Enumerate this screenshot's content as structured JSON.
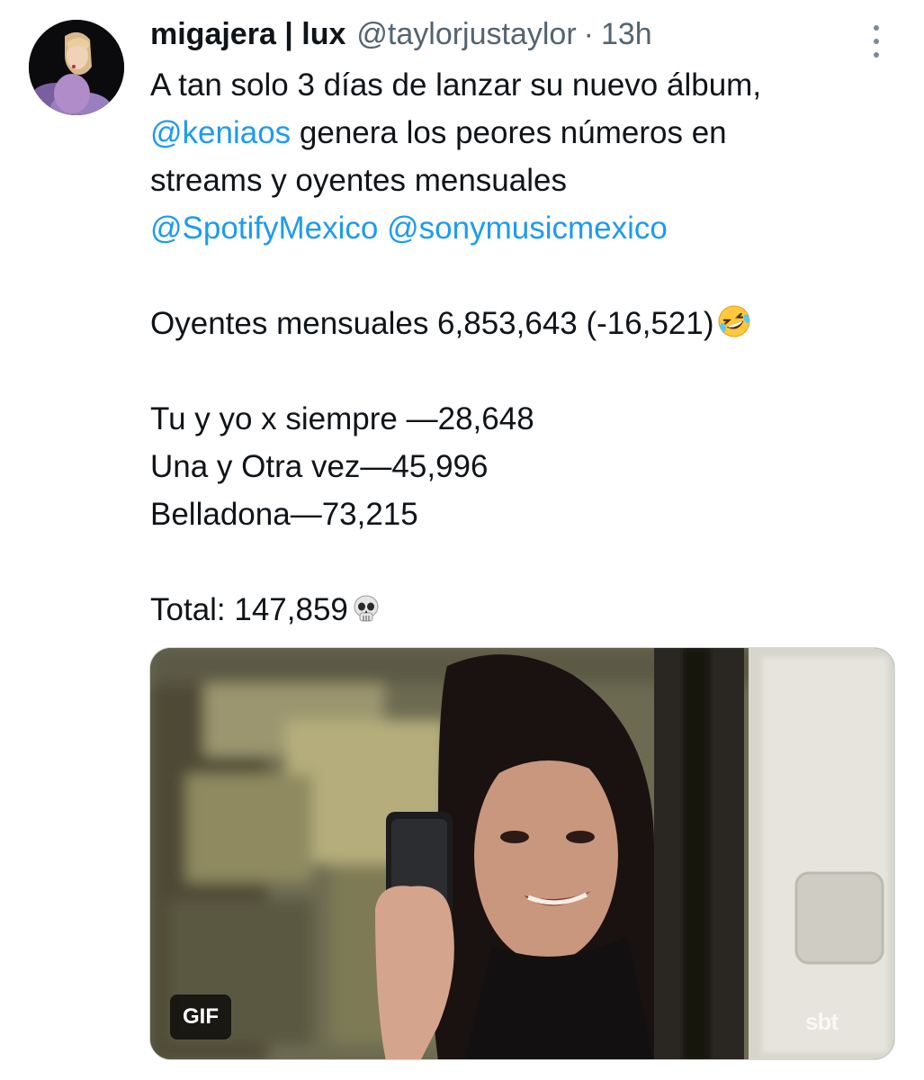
{
  "tweet": {
    "author": {
      "display_name": "migajera | lux",
      "handle": "@taylorjustaylor",
      "avatar_icon": "profile-avatar"
    },
    "separator": "·",
    "time": "13h",
    "more_icon": "vertical-ellipsis-icon",
    "text": {
      "line1": "A tan solo 3 días de lanzar su nuevo álbum,",
      "line2_mention": "@keniaos",
      "line2_rest": " genera los peores números en",
      "line3": "streams y oyentes mensuales",
      "line4_mention1": "@SpotifyMexico",
      "line4_mention2": "@sonymusicmexico",
      "listeners": "Oyentes mensuales 6,853,643 (-16,521)",
      "listeners_emoji": "rolling-on-floor-laughing-emoji",
      "song1": "Tu y yo x siempre —28,648",
      "song2": "Una y Otra vez—45,996",
      "song3": "Belladona—73,215",
      "total": "Total: 147,859",
      "total_emoji": "skull-emoji"
    },
    "media": {
      "type": "gif",
      "badge": "GIF",
      "watermark": "sbt"
    },
    "colors": {
      "text": "#0f1419",
      "secondary": "#536471",
      "mention": "#1d9bf0"
    }
  }
}
